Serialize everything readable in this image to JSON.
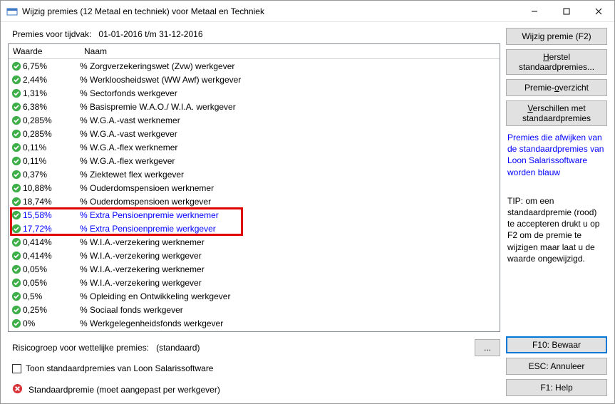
{
  "window": {
    "title": "Wijzig premies (12 Metaal en techniek) voor Metaal en Techniek"
  },
  "period_label": "Premies voor tijdvak:",
  "period_value": "01-01-2016 t/m 31-12-2016",
  "columns": {
    "waarde": "Waarde",
    "naam": "Naam"
  },
  "rows": [
    {
      "waarde": "6,75%",
      "naam": "% Zorgverzekeringswet (Zvw) werkgever",
      "blue": false
    },
    {
      "waarde": "2,44%",
      "naam": "% Werkloosheidswet (WW Awf) werkgever",
      "blue": false
    },
    {
      "waarde": "1,31%",
      "naam": "% Sectorfonds werkgever",
      "blue": false
    },
    {
      "waarde": "6,38%",
      "naam": "% Basispremie W.A.O./ W.I.A. werkgever",
      "blue": false
    },
    {
      "waarde": "0,285%",
      "naam": "% W.G.A.-vast werknemer",
      "blue": false
    },
    {
      "waarde": "0,285%",
      "naam": "% W.G.A.-vast werkgever",
      "blue": false
    },
    {
      "waarde": "0,11%",
      "naam": "% W.G.A.-flex werknemer",
      "blue": false
    },
    {
      "waarde": "0,11%",
      "naam": "% W.G.A.-flex werkgever",
      "blue": false
    },
    {
      "waarde": "0,37%",
      "naam": "% Ziektewet flex werkgever",
      "blue": false
    },
    {
      "waarde": "10,88%",
      "naam": "% Ouderdomspensioen werknemer",
      "blue": false
    },
    {
      "waarde": "18,74%",
      "naam": "% Ouderdomspensioen werkgever",
      "blue": false
    },
    {
      "waarde": "15,58%",
      "naam": "% Extra Pensioenpremie werknemer",
      "blue": true
    },
    {
      "waarde": "17,72%",
      "naam": "% Extra Pensioenpremie werkgever",
      "blue": true
    },
    {
      "waarde": "0,414%",
      "naam": "% W.I.A.-verzekering werknemer",
      "blue": false
    },
    {
      "waarde": "0,414%",
      "naam": "% W.I.A.-verzekering werkgever",
      "blue": false
    },
    {
      "waarde": "0,05%",
      "naam": "% W.I.A.-verzekering werknemer",
      "blue": false
    },
    {
      "waarde": "0,05%",
      "naam": "% W.I.A.-verzekering werkgever",
      "blue": false
    },
    {
      "waarde": "0,5%",
      "naam": "% Opleiding en Ontwikkeling werkgever",
      "blue": false
    },
    {
      "waarde": "0,25%",
      "naam": "% Sociaal fonds werkgever",
      "blue": false
    },
    {
      "waarde": "0%",
      "naam": "% Werkgelegenheidsfonds werkgever",
      "blue": false
    }
  ],
  "risico_label": "Risicogroep voor wettelijke premies:",
  "risico_value": "(standaard)",
  "checkbox_label": "Toon standaardpremies van Loon Salarissoftware",
  "footer_error": "Standaardpremie (moet aangepast per werkgever)",
  "buttons": {
    "wijzig": "Wijzig premie (F2)",
    "herstel_pre": "",
    "herstel_u": "H",
    "herstel_post": "erstel standaardpremies...",
    "overzicht_pre": "Premie-",
    "overzicht_u": "o",
    "overzicht_post": "verzicht",
    "versch_pre": "",
    "versch_u": "V",
    "versch_post": "erschillen met standaardpremies",
    "bewaar": "F10: Bewaar",
    "annuleer": "ESC: Annuleer",
    "help": "F1: Help"
  },
  "side_info": "Premies die afwijken van de standaardpremies van Loon Salarissoftware worden blauw",
  "side_tip": "TIP: om een standaardpremie (rood) te accepteren drukt u op F2 om de premie te wijzigen maar laat u de waarde ongewijzigd.",
  "highlight_start_index": 11,
  "highlight_count": 2
}
